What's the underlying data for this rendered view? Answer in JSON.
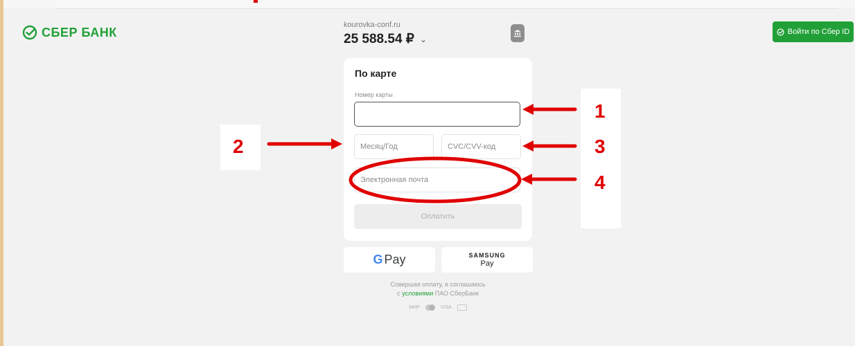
{
  "header": {
    "logo_text": "СБЕР БАНК",
    "merchant": "kourovka-conf.ru",
    "amount": "25 588.54 ₽",
    "sber_id_button": "Войти по Сбер ID"
  },
  "form": {
    "title": "По карте",
    "card_number_label": "Номер карты",
    "card_number_value": "",
    "date_placeholder": "Месяц/Год",
    "cvc_placeholder": "CVC/CVV-код",
    "email_placeholder": "Электронная почта",
    "pay_button": "Оплатить"
  },
  "wallets": {
    "gpay_g": "G",
    "gpay_label": "Pay",
    "samsung_line1": "SAMSUNG",
    "samsung_line2": "Pay"
  },
  "terms": {
    "line1": "Совершая оплату, я соглашаюсь",
    "prefix": "с ",
    "link": "условиями",
    "suffix": " ПАО СберБанк"
  },
  "payment_logos": {
    "mir": "МИР",
    "visa": "VISA"
  },
  "annotations": [
    "1",
    "2",
    "3",
    "4"
  ],
  "colors": {
    "brand_green": "#21a038",
    "annotation_red": "#e00000"
  }
}
